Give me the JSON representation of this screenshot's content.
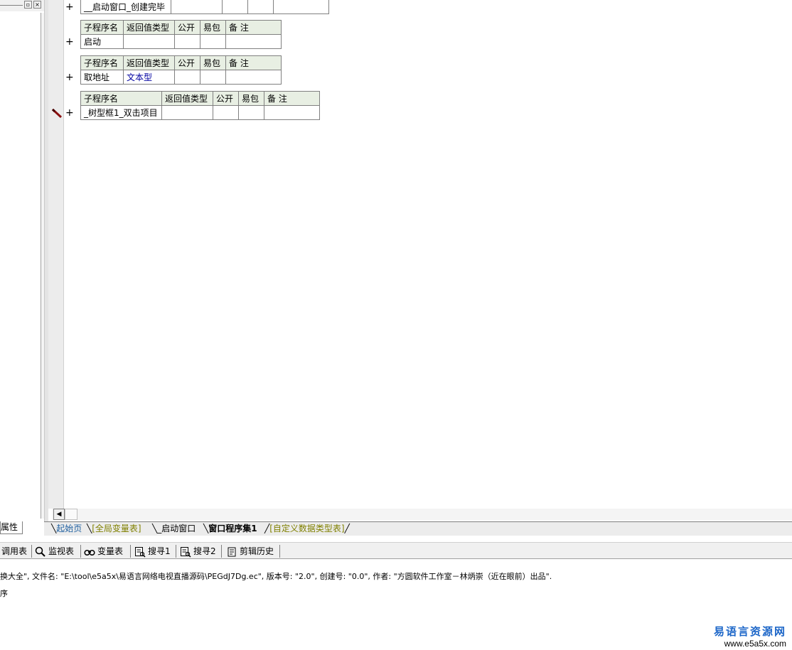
{
  "left_panel": {
    "props_tab": "属性",
    "restore_icon": "▫",
    "close_icon": "×"
  },
  "editor": {
    "top_row": {
      "name": "__启动窗口_创建完毕"
    },
    "tables": [
      {
        "headers": [
          "子程序名",
          "返回值类型",
          "公开",
          "易包",
          "备 注"
        ],
        "name": "启动",
        "return_type": ""
      },
      {
        "headers": [
          "子程序名",
          "返回值类型",
          "公开",
          "易包",
          "备 注"
        ],
        "name": "取地址",
        "return_type": "文本型"
      },
      {
        "headers": [
          "子程序名",
          "返回值类型",
          "公开",
          "易包",
          "备 注"
        ],
        "name": "_树型框1_双击项目",
        "return_type": ""
      }
    ],
    "plus": "+"
  },
  "tabs": [
    "起始页",
    "[全局变量表]",
    "_启动窗口",
    "窗口程序集1",
    "[自定义数据类型表]"
  ],
  "toolbar": {
    "call_table": "调用表",
    "watch": "监视表",
    "vars": "变量表",
    "search1": "搜寻1",
    "search2": "搜寻2",
    "clip_history": "剪辑历史"
  },
  "output": {
    "line1": "换大全\", 文件名: \"E:\\tool\\e5a5x\\易语言网络电视直播源码\\PEGdJ7Dg.ec\", 版本号: \"2.0\", 创建号: \"0.0\", 作者: \"方圆软件工作室－林炳崇（近在眼前）出品\".",
    "line2": "序"
  },
  "watermark": {
    "title": "易语言资源网",
    "url": "www.e5a5x.com"
  }
}
